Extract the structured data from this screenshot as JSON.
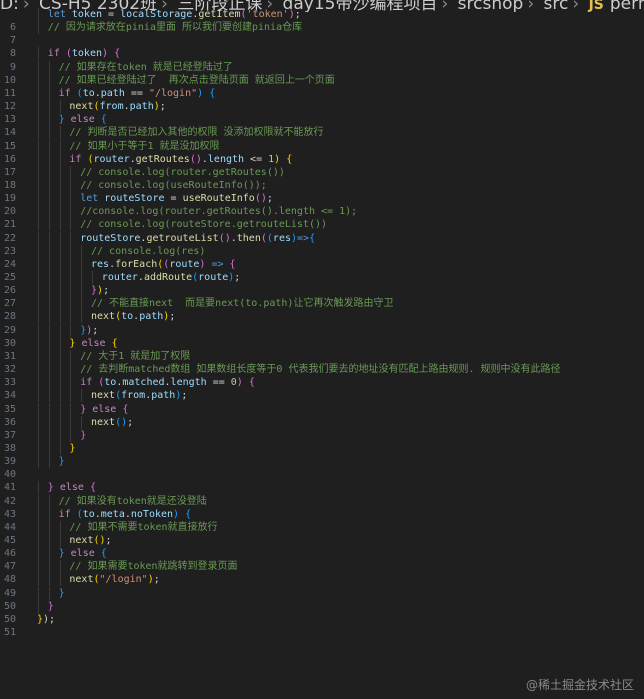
{
  "breadcrumb": {
    "segments": [
      "D:",
      "CS-H5  2302班",
      "三阶段正课",
      "day15带沙编程项目",
      "srcshop",
      "src"
    ],
    "file_icon_text": "JS",
    "file_name": "permission.js"
  },
  "watermark": "@稀土掘金技术社区",
  "colors": {
    "keyword": "#c586c0",
    "storage": "#569cd6",
    "variable": "#9cdcfe",
    "function": "#dcdcaa",
    "string": "#ce9178",
    "number": "#b5cea8",
    "comment": "#6a9955",
    "bracket1": "#ffd700",
    "bracket2": "#da70d6",
    "bracket3": "#179fff"
  },
  "lines": [
    {
      "n": "",
      "indent": 1,
      "tokens": [
        [
          "kwb",
          "let "
        ],
        [
          "var",
          "token"
        ],
        [
          "p",
          " = "
        ],
        [
          "var",
          "localStorage"
        ],
        [
          "p",
          "."
        ],
        [
          "fn",
          "getItem"
        ],
        [
          "b2",
          "("
        ],
        [
          "str",
          "'token'"
        ],
        [
          "b2",
          ")"
        ],
        [
          "p",
          ";"
        ]
      ]
    },
    {
      "n": "6",
      "indent": 1,
      "tokens": [
        [
          "cmt",
          "// 因为请求放在pinia里面 所以我们要创建pinia仓库"
        ]
      ]
    },
    {
      "n": "7",
      "indent": 0,
      "tokens": []
    },
    {
      "n": "8",
      "indent": 1,
      "tokens": [
        [
          "kw",
          "if "
        ],
        [
          "b2",
          "("
        ],
        [
          "var",
          "token"
        ],
        [
          "b2",
          ")"
        ],
        [
          "p",
          " "
        ],
        [
          "b2",
          "{"
        ]
      ]
    },
    {
      "n": "9",
      "indent": 2,
      "tokens": [
        [
          "cmt",
          "// 如果存在token 就是已经登陆过了"
        ]
      ]
    },
    {
      "n": "10",
      "indent": 2,
      "tokens": [
        [
          "cmt",
          "// 如果已经登陆过了  再次点击登陆页面 就返回上一个页面"
        ]
      ]
    },
    {
      "n": "11",
      "indent": 2,
      "tokens": [
        [
          "kw",
          "if "
        ],
        [
          "b3",
          "("
        ],
        [
          "var",
          "to"
        ],
        [
          "p",
          "."
        ],
        [
          "var",
          "path"
        ],
        [
          "p",
          " == "
        ],
        [
          "str",
          "\"/login\""
        ],
        [
          "b3",
          ")"
        ],
        [
          "p",
          " "
        ],
        [
          "b3",
          "{"
        ]
      ]
    },
    {
      "n": "12",
      "indent": 3,
      "tokens": [
        [
          "fn",
          "next"
        ],
        [
          "b1",
          "("
        ],
        [
          "var",
          "from"
        ],
        [
          "p",
          "."
        ],
        [
          "var",
          "path"
        ],
        [
          "b1",
          ")"
        ],
        [
          "p",
          ";"
        ]
      ]
    },
    {
      "n": "13",
      "indent": 2,
      "tokens": [
        [
          "b3",
          "}"
        ],
        [
          "p",
          " "
        ],
        [
          "kw",
          "else "
        ],
        [
          "b3",
          "{"
        ]
      ]
    },
    {
      "n": "14",
      "indent": 3,
      "tokens": [
        [
          "cmt",
          "// 判断是否已经加入其他的权限 没添加权限就不能放行"
        ]
      ]
    },
    {
      "n": "15",
      "indent": 3,
      "tokens": [
        [
          "cmt",
          "// 如果小于等于1 就是没加权限"
        ]
      ]
    },
    {
      "n": "16",
      "indent": 3,
      "tokens": [
        [
          "kw",
          "if "
        ],
        [
          "b1",
          "("
        ],
        [
          "var",
          "router"
        ],
        [
          "p",
          "."
        ],
        [
          "fn",
          "getRoutes"
        ],
        [
          "b2",
          "()"
        ],
        [
          "p",
          "."
        ],
        [
          "var",
          "length"
        ],
        [
          "p",
          " <= "
        ],
        [
          "num",
          "1"
        ],
        [
          "b1",
          ")"
        ],
        [
          "p",
          " "
        ],
        [
          "b1",
          "{"
        ]
      ]
    },
    {
      "n": "17",
      "indent": 4,
      "tokens": [
        [
          "cmt",
          "// console.log(router.getRoutes())"
        ]
      ]
    },
    {
      "n": "18",
      "indent": 4,
      "tokens": [
        [
          "cmt",
          "// console.log(useRouteInfo());"
        ]
      ]
    },
    {
      "n": "19",
      "indent": 4,
      "tokens": [
        [
          "kwb",
          "let "
        ],
        [
          "var",
          "routeStore"
        ],
        [
          "p",
          " = "
        ],
        [
          "fn",
          "useRouteInfo"
        ],
        [
          "b2",
          "()"
        ],
        [
          "p",
          ";"
        ]
      ]
    },
    {
      "n": "20",
      "indent": 4,
      "tokens": [
        [
          "cmt",
          "//console.log(router.getRoutes().length <= 1);"
        ]
      ]
    },
    {
      "n": "21",
      "indent": 4,
      "tokens": [
        [
          "cmt",
          "// console.log(routeStore.getrouteList())"
        ]
      ]
    },
    {
      "n": "22",
      "indent": 4,
      "tokens": [
        [
          "var",
          "routeStore"
        ],
        [
          "p",
          "."
        ],
        [
          "fn",
          "getrouteList"
        ],
        [
          "b2",
          "()"
        ],
        [
          "p",
          "."
        ],
        [
          "fn",
          "then"
        ],
        [
          "b2",
          "("
        ],
        [
          "b3",
          "("
        ],
        [
          "var",
          "res"
        ],
        [
          "b3",
          ")"
        ],
        [
          "kwb",
          "=>"
        ],
        [
          "b3",
          "{"
        ]
      ]
    },
    {
      "n": "23",
      "indent": 5,
      "tokens": [
        [
          "cmt",
          "// console.log(res)"
        ]
      ]
    },
    {
      "n": "24",
      "indent": 5,
      "tokens": [
        [
          "var",
          "res"
        ],
        [
          "p",
          "."
        ],
        [
          "fn",
          "forEach"
        ],
        [
          "b1",
          "("
        ],
        [
          "b2",
          "("
        ],
        [
          "var",
          "route"
        ],
        [
          "b2",
          ")"
        ],
        [
          "kwb",
          " => "
        ],
        [
          "b2",
          "{"
        ]
      ]
    },
    {
      "n": "25",
      "indent": 6,
      "tokens": [
        [
          "var",
          "router"
        ],
        [
          "p",
          "."
        ],
        [
          "fn",
          "addRoute"
        ],
        [
          "b3",
          "("
        ],
        [
          "var",
          "route"
        ],
        [
          "b3",
          ")"
        ],
        [
          "p",
          ";"
        ]
      ]
    },
    {
      "n": "26",
      "indent": 5,
      "tokens": [
        [
          "b2",
          "}"
        ],
        [
          "b1",
          ")"
        ],
        [
          "p",
          ";"
        ]
      ]
    },
    {
      "n": "27",
      "indent": 5,
      "tokens": [
        [
          "cmt",
          "// 不能直接next  而是要next(to.path)让它再次触发路由守卫"
        ]
      ]
    },
    {
      "n": "28",
      "indent": 5,
      "tokens": [
        [
          "fn",
          "next"
        ],
        [
          "b1",
          "("
        ],
        [
          "var",
          "to"
        ],
        [
          "p",
          "."
        ],
        [
          "var",
          "path"
        ],
        [
          "b1",
          ")"
        ],
        [
          "p",
          ";"
        ]
      ]
    },
    {
      "n": "29",
      "indent": 4,
      "tokens": [
        [
          "b3",
          "}"
        ],
        [
          "b2",
          ")"
        ],
        [
          "p",
          ";"
        ]
      ]
    },
    {
      "n": "30",
      "indent": 3,
      "tokens": [
        [
          "b1",
          "}"
        ],
        [
          "p",
          " "
        ],
        [
          "kw",
          "else "
        ],
        [
          "b1",
          "{"
        ]
      ]
    },
    {
      "n": "31",
      "indent": 4,
      "tokens": [
        [
          "cmt",
          "// 大于1 就是加了权限"
        ]
      ]
    },
    {
      "n": "32",
      "indent": 4,
      "tokens": [
        [
          "cmt",
          "// 去判断matched数组 如果数组长度等于0 代表我们要去的地址没有匹配上路由规则. 规则中没有此路径"
        ]
      ]
    },
    {
      "n": "33",
      "indent": 4,
      "tokens": [
        [
          "kw",
          "if "
        ],
        [
          "b2",
          "("
        ],
        [
          "var",
          "to"
        ],
        [
          "p",
          "."
        ],
        [
          "var",
          "matched"
        ],
        [
          "p",
          "."
        ],
        [
          "var",
          "length"
        ],
        [
          "p",
          " == "
        ],
        [
          "num",
          "0"
        ],
        [
          "b2",
          ")"
        ],
        [
          "p",
          " "
        ],
        [
          "b2",
          "{"
        ]
      ]
    },
    {
      "n": "34",
      "indent": 5,
      "tokens": [
        [
          "fn",
          "next"
        ],
        [
          "b3",
          "("
        ],
        [
          "var",
          "from"
        ],
        [
          "p",
          "."
        ],
        [
          "var",
          "path"
        ],
        [
          "b3",
          ")"
        ],
        [
          "p",
          ";"
        ]
      ]
    },
    {
      "n": "35",
      "indent": 4,
      "tokens": [
        [
          "b2",
          "}"
        ],
        [
          "p",
          " "
        ],
        [
          "kw",
          "else "
        ],
        [
          "b2",
          "{"
        ]
      ]
    },
    {
      "n": "36",
      "indent": 5,
      "tokens": [
        [
          "fn",
          "next"
        ],
        [
          "b3",
          "()"
        ],
        [
          "p",
          ";"
        ]
      ]
    },
    {
      "n": "37",
      "indent": 4,
      "tokens": [
        [
          "b2",
          "}"
        ]
      ]
    },
    {
      "n": "38",
      "indent": 3,
      "tokens": [
        [
          "b1",
          "}"
        ]
      ]
    },
    {
      "n": "39",
      "indent": 2,
      "tokens": [
        [
          "b3",
          "}"
        ]
      ]
    },
    {
      "n": "40",
      "indent": 0,
      "tokens": []
    },
    {
      "n": "41",
      "indent": 1,
      "tokens": [
        [
          "b2",
          "}"
        ],
        [
          "p",
          " "
        ],
        [
          "kw",
          "else "
        ],
        [
          "b2",
          "{"
        ]
      ]
    },
    {
      "n": "42",
      "indent": 2,
      "tokens": [
        [
          "cmt",
          "// 如果没有token就是还没登陆"
        ]
      ]
    },
    {
      "n": "43",
      "indent": 2,
      "tokens": [
        [
          "kw",
          "if "
        ],
        [
          "b3",
          "("
        ],
        [
          "var",
          "to"
        ],
        [
          "p",
          "."
        ],
        [
          "var",
          "meta"
        ],
        [
          "p",
          "."
        ],
        [
          "var",
          "noToken"
        ],
        [
          "b3",
          ")"
        ],
        [
          "p",
          " "
        ],
        [
          "b3",
          "{"
        ]
      ]
    },
    {
      "n": "44",
      "indent": 3,
      "tokens": [
        [
          "cmt",
          "// 如果不需要token就直接放行"
        ]
      ]
    },
    {
      "n": "45",
      "indent": 3,
      "tokens": [
        [
          "fn",
          "next"
        ],
        [
          "b1",
          "()"
        ],
        [
          "p",
          ";"
        ]
      ]
    },
    {
      "n": "46",
      "indent": 2,
      "tokens": [
        [
          "b3",
          "}"
        ],
        [
          "p",
          " "
        ],
        [
          "kw",
          "else "
        ],
        [
          "b3",
          "{"
        ]
      ]
    },
    {
      "n": "47",
      "indent": 3,
      "tokens": [
        [
          "cmt",
          "// 如果需要token就跳转到登录页面"
        ]
      ]
    },
    {
      "n": "48",
      "indent": 3,
      "tokens": [
        [
          "fn",
          "next"
        ],
        [
          "b1",
          "("
        ],
        [
          "str",
          "\"/login\""
        ],
        [
          "b1",
          ")"
        ],
        [
          "p",
          ";"
        ]
      ]
    },
    {
      "n": "49",
      "indent": 2,
      "tokens": [
        [
          "b3",
          "}"
        ]
      ]
    },
    {
      "n": "50",
      "indent": 1,
      "tokens": [
        [
          "b2",
          "}"
        ]
      ]
    },
    {
      "n": "50",
      "indent": 0,
      "tokens": [
        [
          "b1",
          "}"
        ],
        [
          "p",
          ");"
        ]
      ]
    },
    {
      "n": "51",
      "indent": 0,
      "tokens": []
    }
  ]
}
